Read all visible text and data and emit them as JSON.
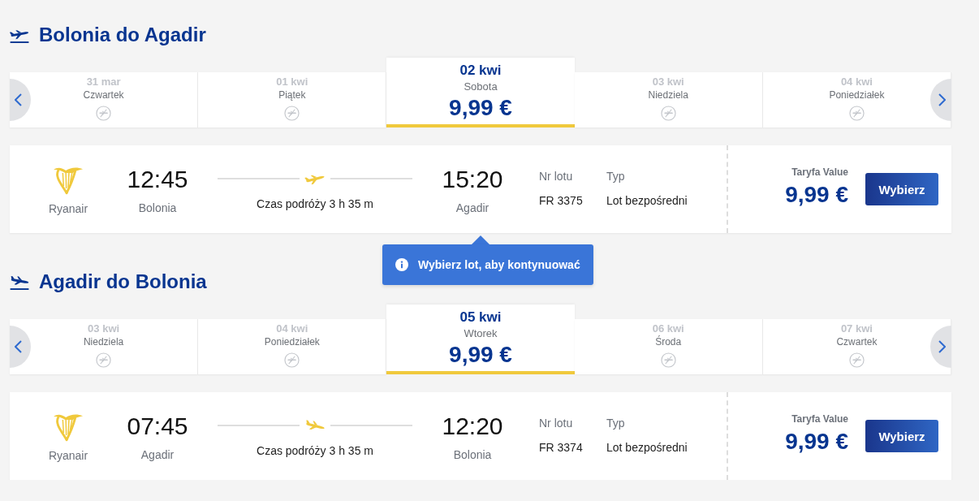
{
  "sections": [
    {
      "title": "Bolonia do Agadir",
      "dates": [
        {
          "date": "31 mar",
          "weekday": "Czwartek",
          "selected": false
        },
        {
          "date": "01 kwi",
          "weekday": "Piątek",
          "selected": false
        },
        {
          "date": "02 kwi",
          "weekday": "Sobota",
          "price": "9,99 €",
          "selected": true
        },
        {
          "date": "03 kwi",
          "weekday": "Niedziela",
          "selected": false
        },
        {
          "date": "04 kwi",
          "weekday": "Poniedziałek",
          "selected": false
        }
      ],
      "flight": {
        "airline": "Ryanair",
        "departure_time": "12:45",
        "departure_city": "Bolonia",
        "duration": "Czas podróży 3 h 35 m",
        "arrival_time": "15:20",
        "arrival_city": "Agadir",
        "number_label": "Nr lotu",
        "number": "FR 3375",
        "flight_type_label": "Typ",
        "flight_type": "Lot bezpośredni",
        "fare_label": "Taryfa Value",
        "price": "9,99 €",
        "button": "Wybierz"
      },
      "notice": "Wybierz lot, aby kontynuować"
    },
    {
      "title": "Agadir do Bolonia",
      "dates": [
        {
          "date": "03 kwi",
          "weekday": "Niedziela",
          "selected": false
        },
        {
          "date": "04 kwi",
          "weekday": "Poniedziałek",
          "selected": false
        },
        {
          "date": "05 kwi",
          "weekday": "Wtorek",
          "price": "9,99 €",
          "selected": true
        },
        {
          "date": "06 kwi",
          "weekday": "Środa",
          "selected": false
        },
        {
          "date": "07 kwi",
          "weekday": "Czwartek",
          "selected": false
        }
      ],
      "flight": {
        "airline": "Ryanair",
        "departure_time": "07:45",
        "departure_city": "Agadir",
        "duration": "Czas podróży 3 h 35 m",
        "arrival_time": "12:20",
        "arrival_city": "Bolonia",
        "number_label": "Nr lotu",
        "number": "FR 3374",
        "flight_type_label": "Typ",
        "flight_type": "Lot bezpośredni",
        "fare_label": "Taryfa Value",
        "price": "9,99 €",
        "button": "Wybierz"
      }
    }
  ]
}
